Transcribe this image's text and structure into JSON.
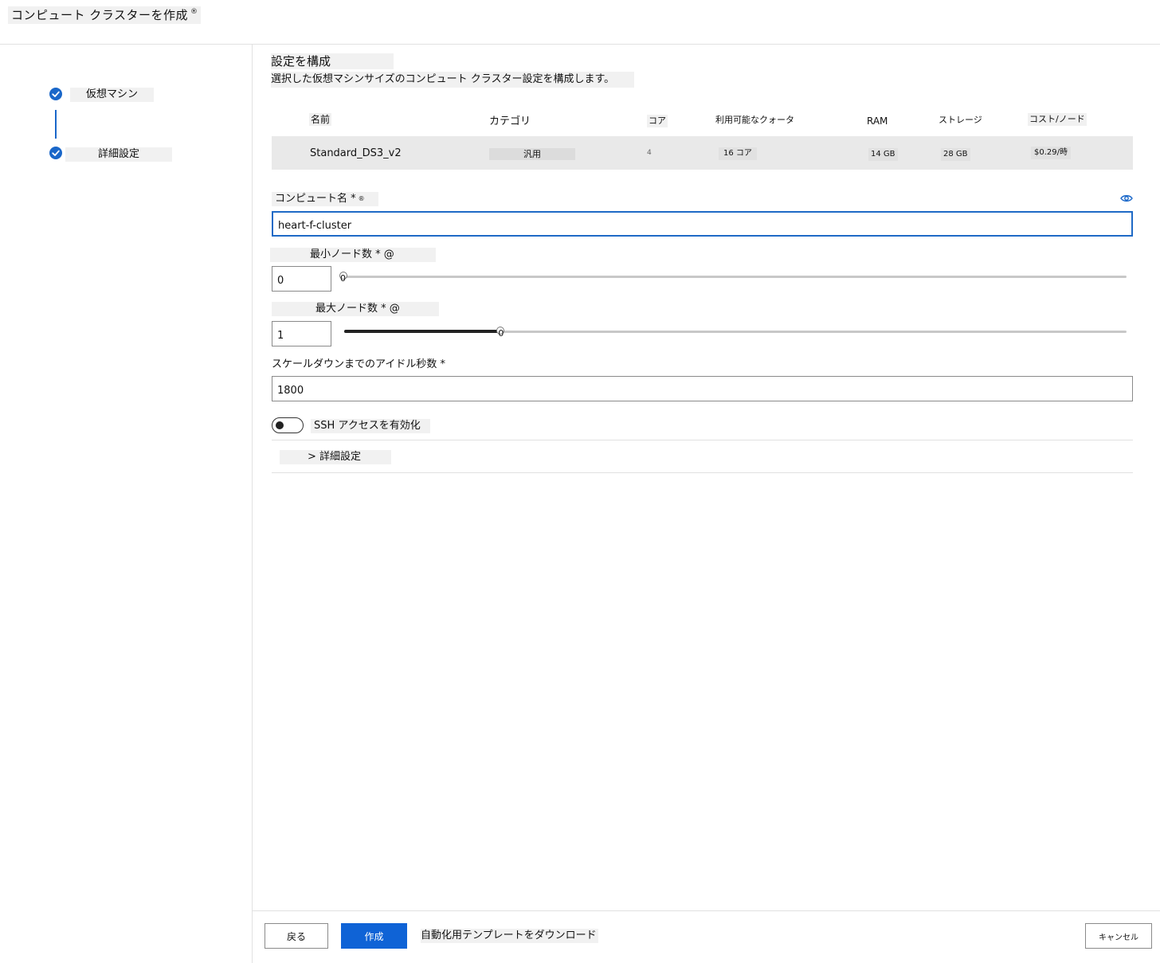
{
  "header": {
    "title": "コンピュート クラスターを作成",
    "info_mark": "®"
  },
  "steps": [
    {
      "label": "仮想マシン",
      "status": "complete"
    },
    {
      "label": "詳細設定",
      "status": "complete"
    }
  ],
  "section": {
    "title": "設定を構成",
    "description": "選択した仮想マシンサイズのコンピュート クラスター設定を構成します。"
  },
  "vm_table": {
    "columns": [
      "名前",
      "カテゴリ",
      "コア",
      "利用可能なクォータ",
      "RAM",
      "ストレージ",
      "コスト/ノード"
    ],
    "row": {
      "name": "Standard_DS3_v2",
      "category": "汎用",
      "cores": "4",
      "quota": "16 コア",
      "ram": "14 GB",
      "storage": "28 GB",
      "cost": "$0.29/時"
    }
  },
  "compute_name": {
    "label": "コンピュート名 *",
    "info_mark": "®",
    "value": "heart-f-cluster"
  },
  "min_nodes": {
    "label": "最小ノード数 * @",
    "value": "0",
    "slider_value": "0",
    "slider_fraction": 0
  },
  "max_nodes": {
    "label": "最大ノード数 * @",
    "value": "1",
    "slider_value": "0",
    "slider_fraction": 0.2
  },
  "idle_seconds": {
    "label": "スケールダウンまでのアイドル秒数 *",
    "value": "1800"
  },
  "ssh": {
    "label": "SSH アクセスを有効化",
    "enabled": false
  },
  "advanced": {
    "label": "> 詳細設定"
  },
  "footer": {
    "back_label": "戻る",
    "create_label": "作成",
    "template_label": "自動化用テンプレートをダウンロード",
    "cancel_label": "キャンセル"
  },
  "colors": {
    "accent": "#1a67c9",
    "primary_button": "#0f63d6",
    "row_background": "#e9e9e9"
  }
}
